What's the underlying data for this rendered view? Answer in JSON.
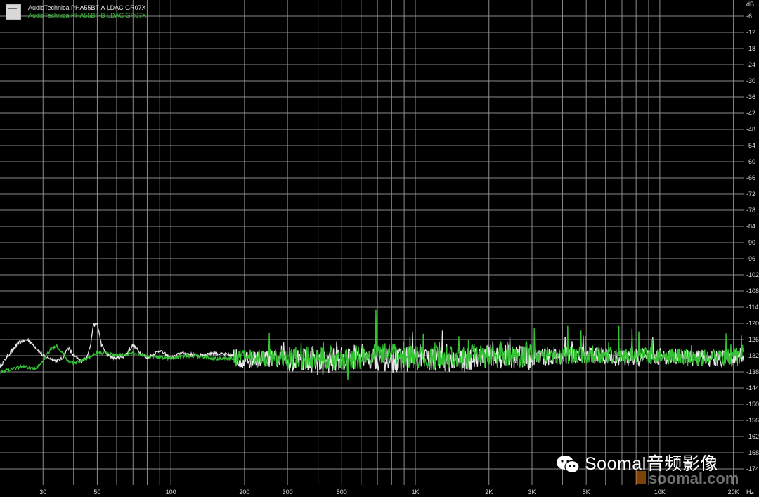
{
  "chart_data": {
    "type": "line",
    "title": "",
    "xlabel": "Hz",
    "ylabel": "dB",
    "x_scale": "log",
    "xlim": [
      20,
      22000
    ],
    "ylim": [
      -180,
      0
    ],
    "grid": true,
    "legend_placement": "top-left",
    "x_ticks": [
      {
        "value": 30,
        "label": "30"
      },
      {
        "value": 50,
        "label": "50"
      },
      {
        "value": 100,
        "label": "100"
      },
      {
        "value": 200,
        "label": "200"
      },
      {
        "value": 300,
        "label": "300"
      },
      {
        "value": 500,
        "label": "500"
      },
      {
        "value": 1000,
        "label": "1K"
      },
      {
        "value": 2000,
        "label": "2K"
      },
      {
        "value": 3000,
        "label": "3K"
      },
      {
        "value": 5000,
        "label": "5K"
      },
      {
        "value": 10000,
        "label": "10K"
      },
      {
        "value": 20000,
        "label": "20K"
      }
    ],
    "y_ticks": [
      -6,
      -12,
      -18,
      -24,
      -30,
      -36,
      -42,
      -48,
      -54,
      -60,
      -66,
      -72,
      -78,
      -84,
      -90,
      -96,
      -102,
      -108,
      -114,
      -120,
      -126,
      -132,
      -138,
      -144,
      -150,
      -156,
      -162,
      -168,
      -174
    ],
    "series": [
      {
        "name": "AudioTechnica PHA55BT-A LDAC GR07X",
        "color": "#e6e6e6",
        "points": [
          [
            20,
            -136
          ],
          [
            22,
            -131
          ],
          [
            24,
            -127
          ],
          [
            26,
            -126
          ],
          [
            28,
            -129
          ],
          [
            30,
            -132
          ],
          [
            32,
            -133
          ],
          [
            34,
            -134
          ],
          [
            36,
            -133
          ],
          [
            38,
            -129
          ],
          [
            40,
            -132
          ],
          [
            43,
            -134
          ],
          [
            45,
            -133
          ],
          [
            47,
            -128
          ],
          [
            48,
            -121
          ],
          [
            50,
            -120
          ],
          [
            52,
            -128
          ],
          [
            55,
            -132
          ],
          [
            60,
            -133
          ],
          [
            65,
            -132
          ],
          [
            70,
            -128
          ],
          [
            75,
            -131
          ],
          [
            80,
            -133
          ],
          [
            90,
            -130
          ],
          [
            100,
            -133
          ],
          [
            110,
            -131
          ],
          [
            130,
            -132
          ],
          [
            150,
            -131
          ],
          [
            180,
            -132
          ],
          [
            200,
            -134
          ],
          [
            250,
            -133
          ],
          [
            300,
            -134
          ],
          [
            350,
            -133
          ],
          [
            400,
            -135
          ],
          [
            500,
            -133
          ],
          [
            600,
            -132
          ],
          [
            700,
            -133
          ],
          [
            800,
            -134
          ],
          [
            1000,
            -133
          ],
          [
            1500,
            -134
          ],
          [
            2000,
            -132
          ],
          [
            3000,
            -133
          ],
          [
            4000,
            -132
          ],
          [
            5000,
            -132
          ],
          [
            7000,
            -133
          ],
          [
            10000,
            -132
          ],
          [
            15000,
            -133
          ],
          [
            20000,
            -133
          ],
          [
            22000,
            -132
          ]
        ],
        "spikes": [
          [
            325,
            -135
          ],
          [
            410,
            -137
          ],
          [
            500,
            -137
          ],
          [
            560,
            -137
          ],
          [
            680,
            -128
          ],
          [
            830,
            -130
          ],
          [
            1250,
            -127
          ],
          [
            4100,
            -125
          ],
          [
            5500,
            -129
          ],
          [
            7700,
            -125
          ]
        ]
      },
      {
        "name": "AudioTechnica PHA55BT-B LDAC GR07X",
        "color": "#34c234",
        "points": [
          [
            20,
            -138
          ],
          [
            22,
            -137
          ],
          [
            25,
            -136
          ],
          [
            28,
            -137
          ],
          [
            30,
            -134
          ],
          [
            32,
            -130
          ],
          [
            34,
            -128
          ],
          [
            36,
            -131
          ],
          [
            38,
            -134
          ],
          [
            40,
            -135
          ],
          [
            45,
            -133
          ],
          [
            48,
            -132
          ],
          [
            50,
            -131
          ],
          [
            55,
            -131
          ],
          [
            60,
            -132
          ],
          [
            70,
            -131
          ],
          [
            80,
            -132
          ],
          [
            100,
            -133
          ],
          [
            120,
            -132
          ],
          [
            150,
            -133
          ],
          [
            180,
            -133
          ],
          [
            200,
            -132
          ],
          [
            250,
            -133
          ],
          [
            300,
            -133
          ],
          [
            400,
            -133
          ],
          [
            500,
            -133
          ],
          [
            700,
            -132
          ],
          [
            1000,
            -132
          ],
          [
            1500,
            -133
          ],
          [
            2000,
            -132
          ],
          [
            3000,
            -132
          ],
          [
            5000,
            -132
          ],
          [
            7000,
            -132
          ],
          [
            10000,
            -132
          ],
          [
            15000,
            -133
          ],
          [
            20000,
            -132
          ],
          [
            22000,
            -132
          ]
        ],
        "spikes": [
          [
            420,
            -127
          ],
          [
            530,
            -141
          ],
          [
            690,
            -115
          ],
          [
            950,
            -125
          ],
          [
            1200,
            -137
          ],
          [
            1650,
            -126
          ],
          [
            4200,
            -121
          ],
          [
            6800,
            -121
          ],
          [
            7700,
            -122
          ],
          [
            8200,
            -123
          ]
        ]
      }
    ]
  },
  "legend": {
    "entries": [
      {
        "label": "AudioTechnica PHA55BT-A LDAC GR07X",
        "color": "#e6e6e6"
      },
      {
        "label": "AudioTechnica PHA55BT-B LDAC GR07X",
        "color": "#34c234"
      }
    ]
  },
  "watermark": {
    "text": "Soomal音频影像",
    "icon": "wechat-icon",
    "site": "soomal.com"
  }
}
